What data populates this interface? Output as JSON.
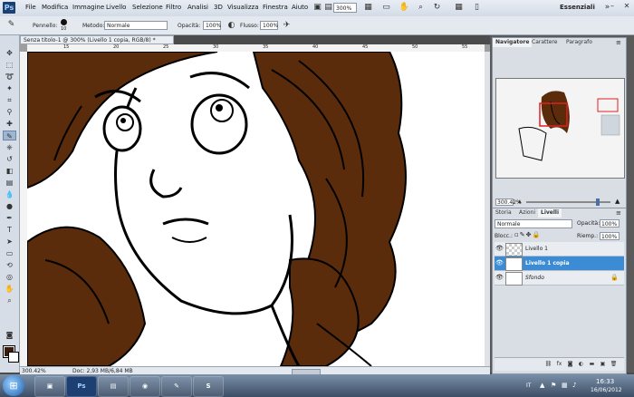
{
  "app": {
    "logo": "Ps",
    "workspace": "Essenziali",
    "zoom": "300%"
  },
  "menu": [
    "File",
    "Modifica",
    "Immagine",
    "Livello",
    "Selezione",
    "Filtro",
    "Analisi",
    "3D",
    "Visualizza",
    "Finestra",
    "Aiuto"
  ],
  "options": {
    "brush_label": "Pennello:",
    "brush_size": "10",
    "mode_label": "Metodo:",
    "mode_value": "Normale",
    "opacity_label": "Opacità:",
    "opacity_value": "100%",
    "flow_label": "Flusso:",
    "flow_value": "100%"
  },
  "document": {
    "tab_title": "Senza titolo-1 @ 300% (Livello 1 copia, RGB/8) *",
    "zoom_status": "300.42%",
    "doc_size": "Doc: 2,93 MB/6,84 MB",
    "ruler_marks": [
      "15",
      "20",
      "25",
      "30",
      "35",
      "40",
      "45",
      "50",
      "55"
    ]
  },
  "navigator": {
    "tabs": [
      "Navigatore",
      "Carattere",
      "Paragrafo"
    ],
    "zoom": "300.42%"
  },
  "layers": {
    "tabs": [
      "Storia",
      "Azioni",
      "Livelli"
    ],
    "blend_mode": "Normale",
    "opacity_label": "Opacità:",
    "opacity_value": "100%",
    "lock_label": "Blocc.:",
    "fill_label": "Riemp.:",
    "fill_value": "100%",
    "items": [
      {
        "name": "Livello 1",
        "selected": false
      },
      {
        "name": "Livello 1 copia",
        "selected": true
      },
      {
        "name": "Sfondo",
        "selected": false
      }
    ]
  },
  "taskbar": {
    "lang": "IT",
    "time": "16:33",
    "date": "16/06/2012",
    "apps": [
      "Ps"
    ]
  },
  "colors": {
    "foreground": "#3a1c0a",
    "background": "#ffffff",
    "hair": "#5b2c0b",
    "selection": "#3b8bd5"
  }
}
